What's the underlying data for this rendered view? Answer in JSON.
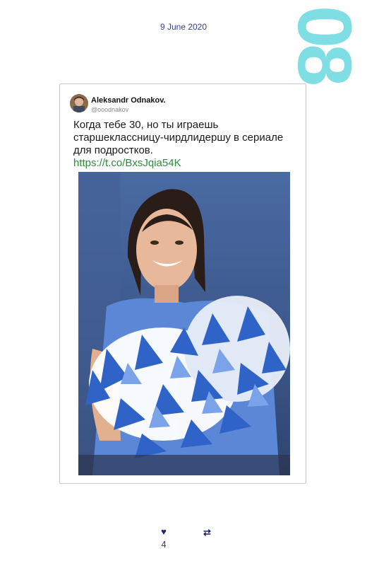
{
  "post": {
    "date": "9 June 2020",
    "index_number": "08"
  },
  "tweet": {
    "author_name": "Aleksandr Odnakov.",
    "author_handle": "@ooodnakov",
    "text": "Когда тебе 30, но ты играешь старшеклассницу-чирдлидершу в сериале для подростков.",
    "link": "https://t.co/BxsJqia54K"
  },
  "actions": {
    "like_icon": "heart-icon",
    "like_count": "4",
    "retweet_icon": "retweet-icon"
  },
  "colors": {
    "date": "#3a3f8f",
    "index_number": "#7fdde4",
    "link": "#2e8b3a",
    "icons": "#1a237e"
  }
}
